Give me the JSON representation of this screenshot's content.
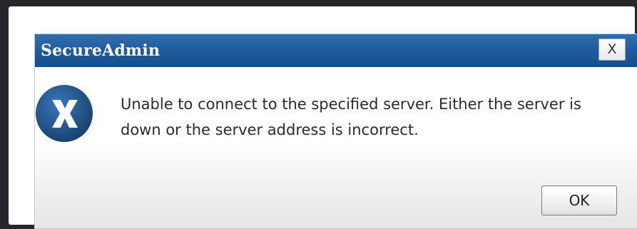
{
  "dialog": {
    "title": "SecureAdmin",
    "close_label": "X",
    "icon": "error-x-icon",
    "message": "Unable to connect to the specified server. Either the server is down or the server address is incorrect.",
    "ok_label": "OK"
  },
  "colors": {
    "titlebar": "#1f5b9c",
    "icon": "#1d4e86",
    "background": "#26272b"
  }
}
